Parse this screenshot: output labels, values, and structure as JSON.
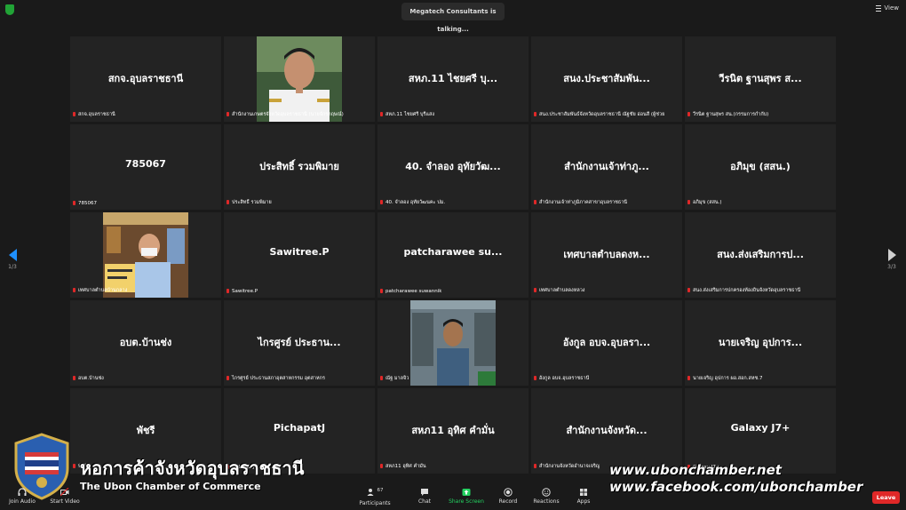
{
  "topbar": {
    "talking": "Megatech Consultants is talking...",
    "view_label": "View"
  },
  "nav": {
    "left_page": "1/3",
    "right_page": "3/3"
  },
  "tiles": [
    {
      "big": "สกจ.อุบลราชธานี",
      "label": "สกจ.อุบลราชธานี"
    },
    {
      "big": "",
      "label": "สำนักงานเกษตรจังหวัดอุบลราชธานี (นายจักรกฤษณ์)",
      "photo": true
    },
    {
      "big": "สหภ.11 ไชยศรี บุ...",
      "label": "สหภ.11 ไชยศรี บุรีแสง"
    },
    {
      "big": "สนง.ประชาสัมพัน...",
      "label": "สนง.ประชาสัมพันธ์จังหวัดอุบลราชธานี ณัฐชัย อ่อนสี (ผู้ช่วย"
    },
    {
      "big": "วีรนิต ฐานสุพร ส...",
      "label": "วีรนิต ฐานสุพร สน.(กรรมการกำกับ)"
    },
    {
      "big": "785067",
      "label": "785067"
    },
    {
      "big": "ประสิทธิ์ รวมพิมาย",
      "label": "ประสิทธิ์ รวมพิมาย"
    },
    {
      "big": "40. จำลอง อุทัยวัฒ...",
      "label": "40. จำลอง อุทัยวัฒนคะ ปม."
    },
    {
      "big": "สำนักงานเจ้าท่าภู...",
      "label": "สำนักงานเจ้าท่าภูมิภาคสาขาอุบลราชธานี"
    },
    {
      "big": "อภิมุข (สสน.)",
      "label": "อภิมุข (สสน.)"
    },
    {
      "big": "",
      "label": "เทศบาลตำบลบ้านกลาง",
      "photo": true
    },
    {
      "big": "Sawitree.P",
      "label": "Sawitree.P"
    },
    {
      "big": "patcharawee su...",
      "label": "patcharawee suwannik"
    },
    {
      "big": "เทศบาลตำบลดงห...",
      "label": "เทศบาลตำบลดงหลวง"
    },
    {
      "big": "สนง.ส่งเสริมการป...",
      "label": "สนง.ส่งเสริมการปกครองท้องถิ่นจังหวัดอุบลราชธานี"
    },
    {
      "big": "อบต.บ้านช่ง",
      "label": "อบต.บ้านช่ง"
    },
    {
      "big": "ไกรศูรย์ ประธาน...",
      "label": "ไกรศูรย์ ประธานสภาอุตสาหกรรม อุตสาหกร"
    },
    {
      "big": "",
      "label": "ณัฐ มาลจิ๋ว",
      "photo": true
    },
    {
      "big": "อังกูล อบจ.อุบลรา...",
      "label": "อังกูล อบจ.อุบลราชธานี"
    },
    {
      "big": "นายเจริญ อุปการ...",
      "label": "นายเจริญ อุปการ ผอ.สอก.สหช.7"
    },
    {
      "big": "พัชรี",
      "label": "พัชรี"
    },
    {
      "big": "PichapatJ",
      "label": "PichapatJ"
    },
    {
      "big": "สหภ11 อุทิศ คำมั่น",
      "label": "สหภ11 อุทิศ คำมั่น"
    },
    {
      "big": "สำนักงานจังหวัด...",
      "label": "สำนักงานจังหวัดอำนาจเจริญ"
    },
    {
      "big": "Galaxy J7+",
      "label": "Galaxy J7+"
    }
  ],
  "watermark": {
    "title": "หอการค้าจังหวัดอุบลราชธานี",
    "subtitle": "The Ubon Chamber of Commerce",
    "website": "www.ubonchamber.net",
    "facebook": "www.facebook.com/ubonchamber"
  },
  "toolbar": {
    "join_audio": "Join Audio",
    "start_video": "Start Video",
    "participants": "Participants",
    "participants_count": "67",
    "chat": "Chat",
    "share_screen": "Share Screen",
    "record": "Record",
    "reactions": "Reactions",
    "apps": "Apps",
    "leave": "Leave"
  },
  "colors": {
    "share_green": "#23d160",
    "leave_red": "#e02828",
    "nav_blue": "#1e90ff"
  }
}
